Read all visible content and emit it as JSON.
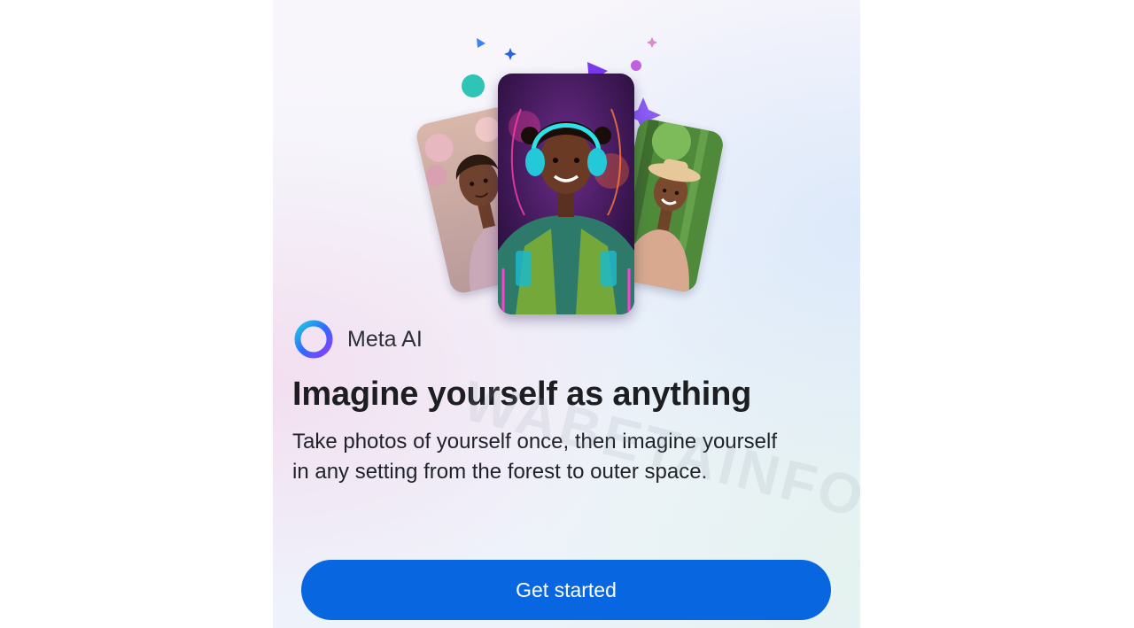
{
  "brand": {
    "name": "Meta AI",
    "ring_colors": [
      "#2f6bff",
      "#1fc8e0",
      "#8b3dff"
    ]
  },
  "hero": {
    "images": [
      "portrait-flowers",
      "portrait-headphones-neon",
      "portrait-forest-hat"
    ]
  },
  "onboarding": {
    "title": "Imagine yourself as anything",
    "description": "Take photos of yourself once, then imagine yourself in any setting from the forest to outer space.",
    "watermark": "WABETAINFO"
  },
  "cta": {
    "label": "Get started",
    "color": "#0866e0"
  }
}
